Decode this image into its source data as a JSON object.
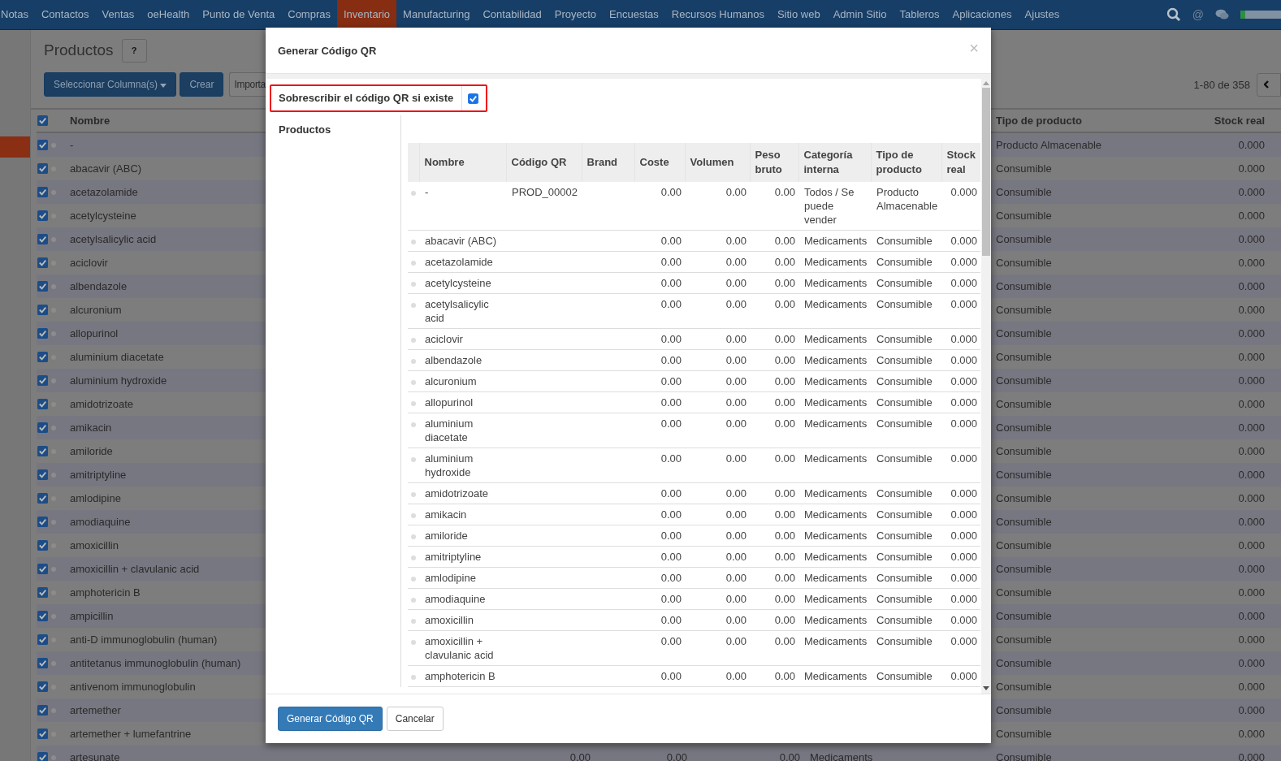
{
  "nav": {
    "items": [
      {
        "label": "Notas",
        "selected": false
      },
      {
        "label": "Contactos",
        "selected": false
      },
      {
        "label": "Ventas",
        "selected": false
      },
      {
        "label": "oeHealth",
        "selected": false
      },
      {
        "label": "Punto de Venta",
        "selected": false
      },
      {
        "label": "Compras",
        "selected": false
      },
      {
        "label": "Inventario",
        "selected": true
      },
      {
        "label": "Manufacturing",
        "selected": false
      },
      {
        "label": "Contabilidad",
        "selected": false
      },
      {
        "label": "Proyecto",
        "selected": false
      },
      {
        "label": "Encuestas",
        "selected": false
      },
      {
        "label": "Recursos Humanos",
        "selected": false
      },
      {
        "label": "Sitio web",
        "selected": false
      },
      {
        "label": "Admin Sitio",
        "selected": false
      },
      {
        "label": "Tableros",
        "selected": false
      },
      {
        "label": "Aplicaciones",
        "selected": false
      },
      {
        "label": "Ajustes",
        "selected": false
      }
    ],
    "mention": "@"
  },
  "page": {
    "title": "Productos",
    "help": "?",
    "buttons": [
      "Seleccionar Columna(s)",
      "Crear",
      "Importa"
    ],
    "pager": "1-80 de 358",
    "columns": [
      "Nombre",
      "Tipo de producto",
      "Stock real"
    ],
    "select_all": true,
    "rows": [
      {
        "name": "-",
        "type": "Producto Almacenable",
        "stock": "0.000",
        "checked": true
      },
      {
        "name": "abacavir (ABC)",
        "type": "Consumible",
        "stock": "0.000",
        "checked": true
      },
      {
        "name": "acetazolamide",
        "type": "Consumible",
        "stock": "0.000",
        "checked": true
      },
      {
        "name": "acetylcysteine",
        "type": "Consumible",
        "stock": "0.000",
        "checked": true
      },
      {
        "name": "acetylsalicylic acid",
        "type": "Consumible",
        "stock": "0.000",
        "checked": true
      },
      {
        "name": "aciclovir",
        "type": "Consumible",
        "stock": "0.000",
        "checked": true
      },
      {
        "name": "albendazole",
        "type": "Consumible",
        "stock": "0.000",
        "checked": true
      },
      {
        "name": "alcuronium",
        "type": "Consumible",
        "stock": "0.000",
        "checked": true
      },
      {
        "name": "allopurinol",
        "type": "Consumible",
        "stock": "0.000",
        "checked": true
      },
      {
        "name": "aluminium diacetate",
        "type": "Consumible",
        "stock": "0.000",
        "checked": true
      },
      {
        "name": "aluminium hydroxide",
        "type": "Consumible",
        "stock": "0.000",
        "checked": true
      },
      {
        "name": "amidotrizoate",
        "type": "Consumible",
        "stock": "0.000",
        "checked": true
      },
      {
        "name": "amikacin",
        "type": "Consumible",
        "stock": "0.000",
        "checked": true
      },
      {
        "name": "amiloride",
        "type": "Consumible",
        "stock": "0.000",
        "checked": true
      },
      {
        "name": "amitriptyline",
        "type": "Consumible",
        "stock": "0.000",
        "checked": true
      },
      {
        "name": "amlodipine",
        "type": "Consumible",
        "stock": "0.000",
        "checked": true
      },
      {
        "name": "amodiaquine",
        "type": "Consumible",
        "stock": "0.000",
        "checked": true
      },
      {
        "name": "amoxicillin",
        "type": "Consumible",
        "stock": "0.000",
        "checked": true
      },
      {
        "name": "amoxicillin + clavulanic acid",
        "type": "Consumible",
        "stock": "0.000",
        "checked": true
      },
      {
        "name": "amphotericin B",
        "type": "Consumible",
        "stock": "0.000",
        "checked": true
      },
      {
        "name": "ampicillin",
        "type": "Consumible",
        "stock": "0.000",
        "checked": true
      },
      {
        "name": "anti-D immunoglobulin (human)",
        "type": "Consumible",
        "stock": "0.000",
        "checked": true
      },
      {
        "name": "antitetanus immunoglobulin (human)",
        "type": "Consumible",
        "stock": "0.000",
        "checked": true
      },
      {
        "name": "antivenom immunoglobulin",
        "type": "Consumible",
        "stock": "0.000",
        "checked": true
      },
      {
        "name": "artemether",
        "type": "Consumible",
        "stock": "0.000",
        "checked": true
      },
      {
        "name": "artemether + lumefantrine",
        "type": "Consumible",
        "stock": "0.000",
        "checked": true
      },
      {
        "name": "artesunate",
        "type": "Consumible",
        "stock": "0.000",
        "checked": true,
        "coste": "0.00",
        "volumen": "0.00",
        "peso": "0.00",
        "categoria": "Medicaments"
      }
    ]
  },
  "dialog": {
    "title": "Generar Código QR",
    "close": "×",
    "overwrite_label": "Sobrescribir el código QR si existe",
    "overwrite": true,
    "products_label": "Productos",
    "columns": [
      "Nombre",
      "Código QR",
      "Brand",
      "Coste",
      "Volumen",
      "Peso bruto",
      "Categoría interna",
      "Tipo de producto",
      "Stock real"
    ],
    "rows": [
      {
        "name": "-",
        "code": "PROD_00002",
        "coste": "0.00",
        "volumen": "0.00",
        "peso": "0.00",
        "categoria": "Todos / Se puede vender",
        "tipo": "Producto Almacenable",
        "stock": "0.000"
      },
      {
        "name": "abacavir (ABC)",
        "coste": "0.00",
        "volumen": "0.00",
        "peso": "0.00",
        "categoria": "Medicaments",
        "tipo": "Consumible",
        "stock": "0.000"
      },
      {
        "name": "acetazolamide",
        "coste": "0.00",
        "volumen": "0.00",
        "peso": "0.00",
        "categoria": "Medicaments",
        "tipo": "Consumible",
        "stock": "0.000"
      },
      {
        "name": "acetylcysteine",
        "coste": "0.00",
        "volumen": "0.00",
        "peso": "0.00",
        "categoria": "Medicaments",
        "tipo": "Consumible",
        "stock": "0.000"
      },
      {
        "name": "acetylsalicylic acid",
        "coste": "0.00",
        "volumen": "0.00",
        "peso": "0.00",
        "categoria": "Medicaments",
        "tipo": "Consumible",
        "stock": "0.000"
      },
      {
        "name": "aciclovir",
        "coste": "0.00",
        "volumen": "0.00",
        "peso": "0.00",
        "categoria": "Medicaments",
        "tipo": "Consumible",
        "stock": "0.000"
      },
      {
        "name": "albendazole",
        "coste": "0.00",
        "volumen": "0.00",
        "peso": "0.00",
        "categoria": "Medicaments",
        "tipo": "Consumible",
        "stock": "0.000"
      },
      {
        "name": "alcuronium",
        "coste": "0.00",
        "volumen": "0.00",
        "peso": "0.00",
        "categoria": "Medicaments",
        "tipo": "Consumible",
        "stock": "0.000"
      },
      {
        "name": "allopurinol",
        "coste": "0.00",
        "volumen": "0.00",
        "peso": "0.00",
        "categoria": "Medicaments",
        "tipo": "Consumible",
        "stock": "0.000"
      },
      {
        "name": "aluminium diacetate",
        "coste": "0.00",
        "volumen": "0.00",
        "peso": "0.00",
        "categoria": "Medicaments",
        "tipo": "Consumible",
        "stock": "0.000"
      },
      {
        "name": "aluminium hydroxide",
        "coste": "0.00",
        "volumen": "0.00",
        "peso": "0.00",
        "categoria": "Medicaments",
        "tipo": "Consumible",
        "stock": "0.000"
      },
      {
        "name": "amidotrizoate",
        "coste": "0.00",
        "volumen": "0.00",
        "peso": "0.00",
        "categoria": "Medicaments",
        "tipo": "Consumible",
        "stock": "0.000"
      },
      {
        "name": "amikacin",
        "coste": "0.00",
        "volumen": "0.00",
        "peso": "0.00",
        "categoria": "Medicaments",
        "tipo": "Consumible",
        "stock": "0.000"
      },
      {
        "name": "amiloride",
        "coste": "0.00",
        "volumen": "0.00",
        "peso": "0.00",
        "categoria": "Medicaments",
        "tipo": "Consumible",
        "stock": "0.000"
      },
      {
        "name": "amitriptyline",
        "coste": "0.00",
        "volumen": "0.00",
        "peso": "0.00",
        "categoria": "Medicaments",
        "tipo": "Consumible",
        "stock": "0.000"
      },
      {
        "name": "amlodipine",
        "coste": "0.00",
        "volumen": "0.00",
        "peso": "0.00",
        "categoria": "Medicaments",
        "tipo": "Consumible",
        "stock": "0.000"
      },
      {
        "name": "amodiaquine",
        "coste": "0.00",
        "volumen": "0.00",
        "peso": "0.00",
        "categoria": "Medicaments",
        "tipo": "Consumible",
        "stock": "0.000"
      },
      {
        "name": "amoxicillin",
        "coste": "0.00",
        "volumen": "0.00",
        "peso": "0.00",
        "categoria": "Medicaments",
        "tipo": "Consumible",
        "stock": "0.000"
      },
      {
        "name": "amoxicillin + clavulanic acid",
        "coste": "0.00",
        "volumen": "0.00",
        "peso": "0.00",
        "categoria": "Medicaments",
        "tipo": "Consumible",
        "stock": "0.000"
      },
      {
        "name": "amphotericin B",
        "coste": "0.00",
        "volumen": "0.00",
        "peso": "0.00",
        "categoria": "Medicaments",
        "tipo": "Consumible",
        "stock": "0.000"
      }
    ],
    "buttons": [
      {
        "label": "Generar Código QR",
        "kind": "primary"
      },
      {
        "label": "Cancelar",
        "kind": "default"
      }
    ]
  }
}
